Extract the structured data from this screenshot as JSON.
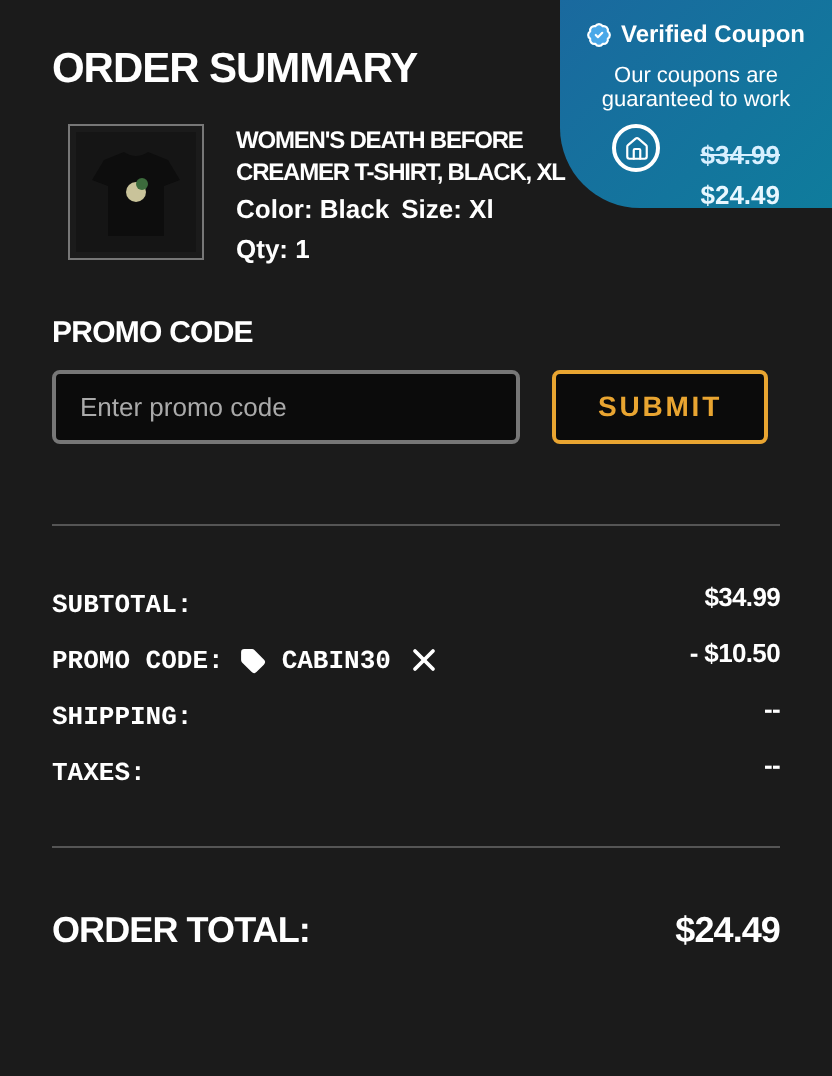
{
  "title": "ORDER SUMMARY",
  "product": {
    "name": "WOMEN'S DEATH BEFORE CREAMER T-SHIRT, BLACK, XL",
    "color_text": "Color: Black",
    "size": "Size: Xl",
    "qty": "Qty: 1",
    "original_price": "$34.99",
    "price": "$24.49"
  },
  "promo": {
    "label": "PROMO CODE",
    "placeholder": "Enter promo code",
    "button": "SUBMIT"
  },
  "lines": [
    {
      "kind": "plain",
      "label": "SUBTOTAL:",
      "value": "$34.99"
    },
    {
      "kind": "promo",
      "label": "PROMO CODE:",
      "code": "CABIN30",
      "value": "- $10.50"
    },
    {
      "kind": "plain",
      "label": "SHIPPING:",
      "value": "--"
    },
    {
      "kind": "plain",
      "label": "TAXES:",
      "value": "--"
    }
  ],
  "total": {
    "label": "ORDER TOTAL:",
    "value": "$24.49"
  },
  "coupon_popup": {
    "title": "Verified Coupon",
    "text": "Our coupons are guaranteed to work"
  }
}
